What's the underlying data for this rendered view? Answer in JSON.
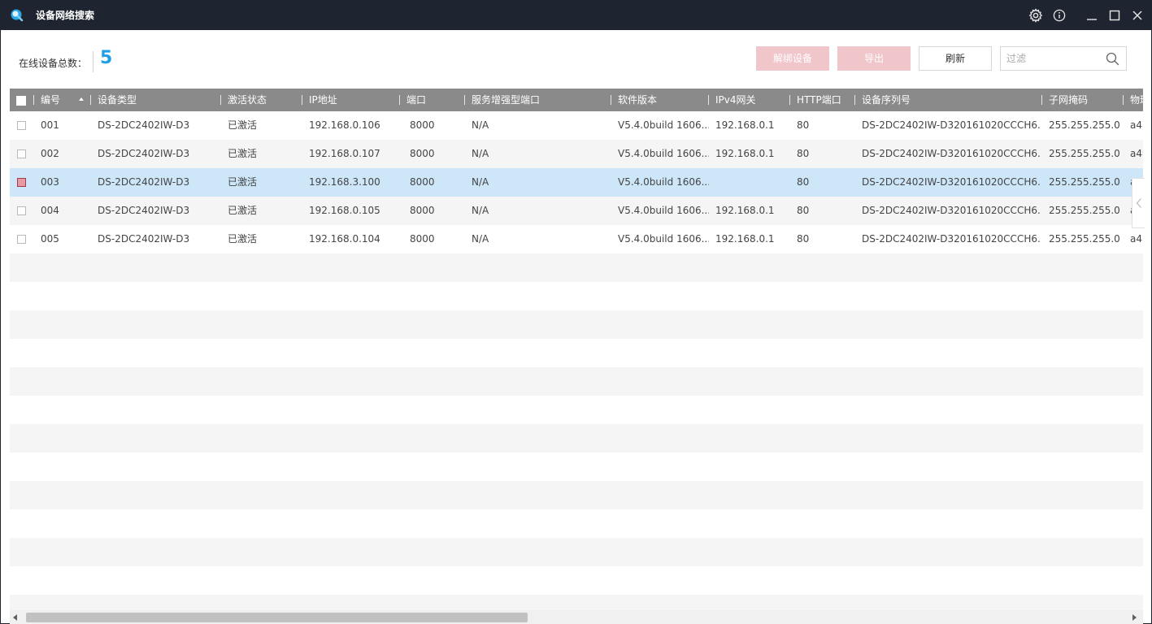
{
  "window": {
    "title": "设备网络搜索",
    "icons": {
      "logo": "search-globe-icon",
      "settings": "gear-icon",
      "info": "info-icon",
      "minimize": "minimize-icon",
      "maximize": "maximize-icon",
      "close": "close-icon"
    }
  },
  "toolbar": {
    "online_count_label": "在线设备总数：",
    "online_count": "5",
    "unbind_label": "解绑设备",
    "export_label": "导出",
    "refresh_label": "刷新",
    "filter_placeholder": "过滤"
  },
  "table": {
    "columns": [
      "编号",
      "设备类型",
      "激活状态",
      "IP地址",
      "端口",
      "服务增强型端口",
      "软件版本",
      "IPv4网关",
      "HTTP端口",
      "设备序列号",
      "子网掩码",
      "物理"
    ],
    "rows": [
      {
        "id": "001",
        "type": "DS-2DC2402IW-D3",
        "status": "已激活",
        "ip": "192.168.0.106",
        "port": "8000",
        "enh_port": "N/A",
        "version": "V5.4.0build 1606...",
        "gateway": "192.168.0.1",
        "http": "80",
        "serial": "DS-2DC2402IW-D320161020CCCH6...",
        "mask": "255.255.255.0",
        "mac": "a4",
        "checked": false,
        "selected": false
      },
      {
        "id": "002",
        "type": "DS-2DC2402IW-D3",
        "status": "已激活",
        "ip": "192.168.0.107",
        "port": "8000",
        "enh_port": "N/A",
        "version": "V5.4.0build 1606...",
        "gateway": "192.168.0.1",
        "http": "80",
        "serial": "DS-2DC2402IW-D320161020CCCH6...",
        "mask": "255.255.255.0",
        "mac": "a4",
        "checked": false,
        "selected": false
      },
      {
        "id": "003",
        "type": "DS-2DC2402IW-D3",
        "status": "已激活",
        "ip": "192.168.3.100",
        "port": "8000",
        "enh_port": "N/A",
        "version": "V5.4.0build 1606...",
        "gateway": "",
        "http": "80",
        "serial": "DS-2DC2402IW-D320161020CCCH6...",
        "mask": "255.255.255.0",
        "mac": "a",
        "checked": true,
        "selected": true
      },
      {
        "id": "004",
        "type": "DS-2DC2402IW-D3",
        "status": "已激活",
        "ip": "192.168.0.105",
        "port": "8000",
        "enh_port": "N/A",
        "version": "V5.4.0build 1606...",
        "gateway": "192.168.0.1",
        "http": "80",
        "serial": "DS-2DC2402IW-D320161020CCCH6...",
        "mask": "255.255.255.0",
        "mac": "a",
        "checked": false,
        "selected": false
      },
      {
        "id": "005",
        "type": "DS-2DC2402IW-D3",
        "status": "已激活",
        "ip": "192.168.0.104",
        "port": "8000",
        "enh_port": "N/A",
        "version": "V5.4.0build 1606...",
        "gateway": "192.168.0.1",
        "http": "80",
        "serial": "DS-2DC2402IW-D320161020CCCH6...",
        "mask": "255.255.255.0",
        "mac": "a4",
        "checked": false,
        "selected": false
      }
    ]
  },
  "colors": {
    "titlebar": "#1f2530",
    "accent": "#1e9fe8",
    "header": "#8a8a8a",
    "selected_row": "#cde7f9",
    "disabled_button": "#f0c6cb"
  }
}
